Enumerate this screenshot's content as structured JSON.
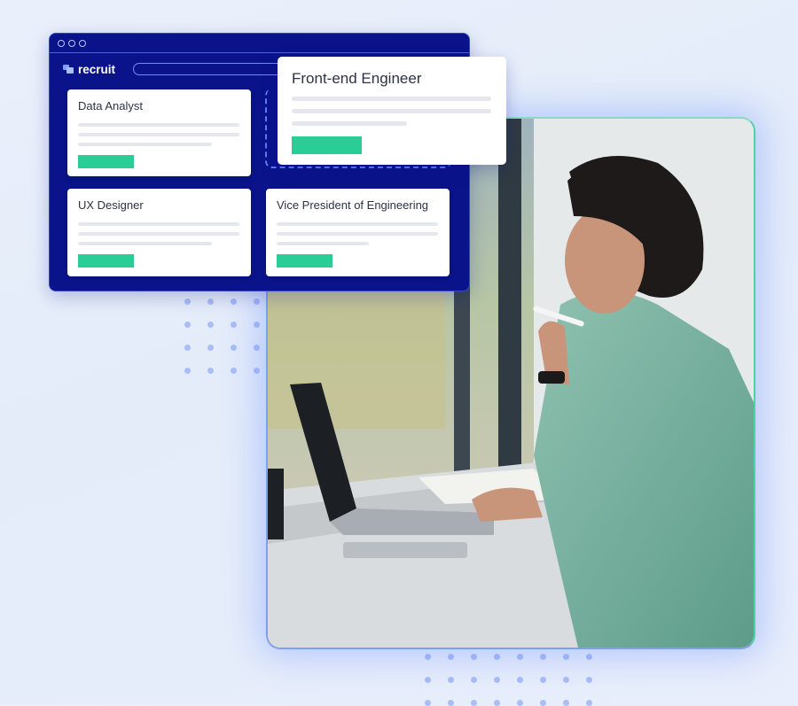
{
  "app": {
    "brand": "recruit",
    "window_controls": [
      "dot",
      "dot",
      "dot"
    ]
  },
  "job_cards": [
    {
      "title": "Data Analyst"
    },
    {
      "title": "UX Designer"
    },
    {
      "title": "Vice President of Engineering"
    }
  ],
  "featured_card": {
    "title": "Front-end Engineer"
  },
  "colors": {
    "window_bg": "#0a1389",
    "accent_green": "#2ccc96",
    "dot_blue": "#a9bdf6"
  },
  "photo": {
    "description": "Woman with glasses working on laptop at a desk"
  }
}
